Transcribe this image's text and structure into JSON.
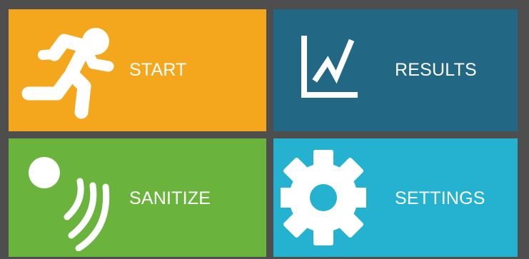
{
  "tiles": {
    "start": {
      "label": "START",
      "icon": "running-person-icon",
      "color": "#f4a71d"
    },
    "results": {
      "label": "RESULTS",
      "icon": "line-chart-icon",
      "color": "#226784"
    },
    "sanitize": {
      "label": "SANITIZE",
      "icon": "wave-signal-icon",
      "color": "#6ab43d"
    },
    "settings": {
      "label": "SETTINGS",
      "icon": "gear-icon",
      "color": "#25b2d1"
    }
  },
  "colors": {
    "background": "#4e4e4e",
    "label_text": "#ffffff"
  }
}
